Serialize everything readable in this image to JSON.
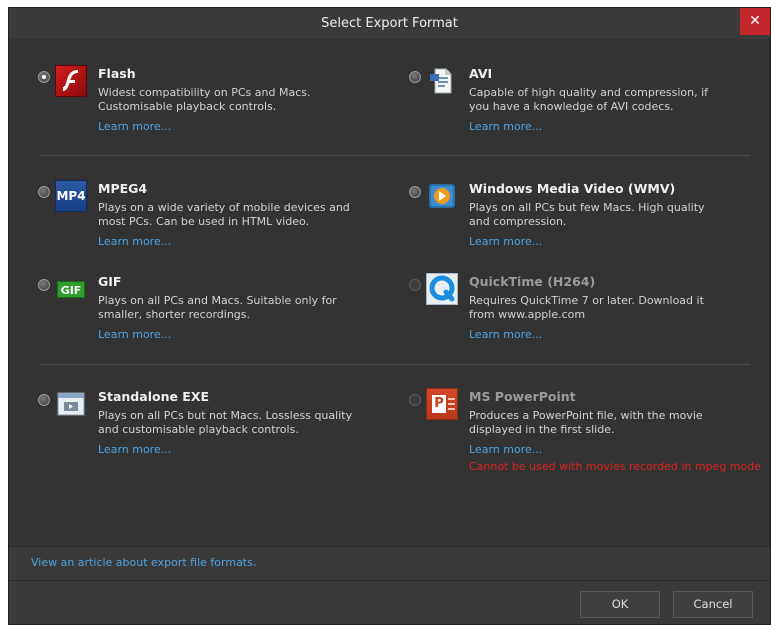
{
  "dialog": {
    "title": "Select Export Format",
    "close_label": "✕"
  },
  "options": [
    {
      "id": "flash",
      "title": "Flash",
      "desc": "Widest compatibility on PCs and Macs. Customisable playback controls.",
      "learn": "Learn more...",
      "selected": true,
      "enabled": true,
      "icon": "flash-icon"
    },
    {
      "id": "avi",
      "title": "AVI",
      "desc": "Capable of high quality and compression, if you have a knowledge of AVI codecs.",
      "learn": "Learn more...",
      "selected": false,
      "enabled": true,
      "icon": "avi-icon"
    },
    {
      "id": "mpeg4",
      "title": "MPEG4",
      "desc": "Plays on a wide variety of mobile devices and most PCs. Can be used in HTML video.",
      "learn": "Learn more...",
      "selected": false,
      "enabled": true,
      "icon": "mp4-icon",
      "icon_text": "MP4"
    },
    {
      "id": "wmv",
      "title": "Windows Media Video (WMV)",
      "desc": "Plays on all PCs but few Macs. High quality and compression.",
      "learn": "Learn more...",
      "selected": false,
      "enabled": true,
      "icon": "wmv-icon"
    },
    {
      "id": "gif",
      "title": "GIF",
      "desc": "Plays on all PCs and Macs. Suitable only for smaller, shorter recordings.",
      "learn": "Learn more...",
      "selected": false,
      "enabled": true,
      "icon": "gif-icon",
      "icon_text": "GIF"
    },
    {
      "id": "quicktime",
      "title": "QuickTime (H264)",
      "desc": "Requires QuickTime 7 or later. Download it from www.apple.com",
      "learn": "Learn more...",
      "selected": false,
      "enabled": false,
      "icon": "quicktime-icon"
    },
    {
      "id": "exe",
      "title": "Standalone EXE",
      "desc": "Plays on all PCs but not Macs. Lossless quality and customisable playback controls.",
      "learn": "Learn more...",
      "selected": false,
      "enabled": true,
      "icon": "exe-icon"
    },
    {
      "id": "powerpoint",
      "title": "MS PowerPoint",
      "desc": "Produces a PowerPoint file, with the movie displayed in the first slide.",
      "learn": "Learn more...",
      "warning": "Cannot be used with movies recorded in mpeg mode",
      "selected": false,
      "enabled": false,
      "icon": "powerpoint-icon",
      "icon_text": "P"
    }
  ],
  "footer": {
    "article_link": "View an article about export file formats.",
    "ok_label": "OK",
    "cancel_label": "Cancel"
  },
  "colors": {
    "link": "#4fa3e0",
    "warning": "#e02222",
    "close_button": "#c2272d"
  }
}
